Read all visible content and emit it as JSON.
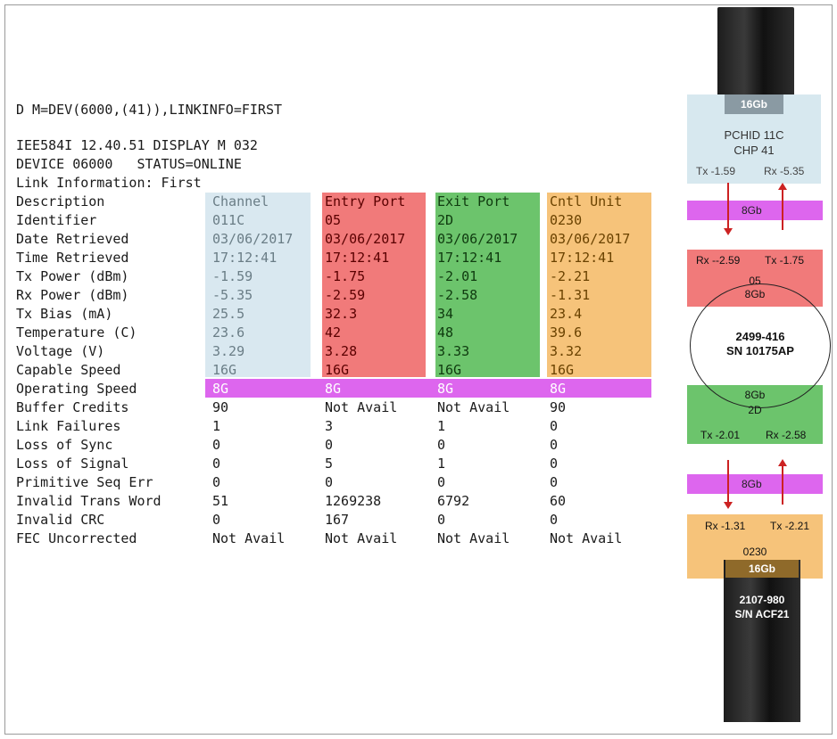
{
  "command": "D M=DEV(6000,(41)),LINKINFO=FIRST",
  "header_lines": [
    "IEE584I 12.40.51 DISPLAY M 032",
    "DEVICE 06000   STATUS=ONLINE",
    "Link Information: First"
  ],
  "table": {
    "description_label": "Description",
    "columns": [
      "Channel",
      "Entry Port",
      "Exit Port",
      "Cntl Unit"
    ],
    "column_colors": [
      "#d9e8f0",
      "#f17a7a",
      "#6cc46c",
      "#f6c37a"
    ],
    "rows": [
      {
        "label": "Identifier",
        "values": [
          "011C",
          "05",
          "2D",
          "0230"
        ]
      },
      {
        "label": "Date Retrieved",
        "values": [
          "03/06/2017",
          "03/06/2017",
          "03/06/2017",
          "03/06/2017"
        ]
      },
      {
        "label": "Time Retrieved",
        "values": [
          "17:12:41",
          "17:12:41",
          "17:12:41",
          "17:12:41"
        ]
      },
      {
        "label": "Tx Power (dBm)",
        "values": [
          "-1.59",
          "-1.75",
          "-2.01",
          "-2.21"
        ]
      },
      {
        "label": "Rx Power (dBm)",
        "values": [
          "-5.35",
          "-2.59",
          "-2.58",
          "-1.31"
        ]
      },
      {
        "label": "Tx Bias (mA)",
        "values": [
          "25.5",
          "32.3",
          "34",
          "23.4"
        ]
      },
      {
        "label": "Temperature (C)",
        "values": [
          "23.6",
          "42",
          "48",
          "39.6"
        ]
      },
      {
        "label": "Voltage (V)",
        "values": [
          "3.29",
          "3.28",
          "3.33",
          "3.32"
        ]
      },
      {
        "label": "Capable Speed",
        "values": [
          "16G",
          "16G",
          "16G",
          "16G"
        ]
      },
      {
        "label": "Operating Speed",
        "values": [
          "8G",
          "8G",
          "8G",
          "8G"
        ]
      },
      {
        "label": "Buffer Credits",
        "values": [
          "90",
          "Not Avail",
          "Not Avail",
          "90"
        ]
      },
      {
        "label": "Link Failures",
        "values": [
          "1",
          "3",
          "1",
          "0"
        ]
      },
      {
        "label": "Loss of Sync",
        "values": [
          "0",
          "0",
          "0",
          "0"
        ]
      },
      {
        "label": "Loss of Signal",
        "values": [
          "0",
          "5",
          "1",
          "0"
        ]
      },
      {
        "label": "Primitive Seq Err",
        "values": [
          "0",
          "0",
          "0",
          "0"
        ]
      },
      {
        "label": "Invalid Trans Word",
        "values": [
          "51",
          "1269238",
          "6792",
          "60"
        ]
      },
      {
        "label": "Invalid CRC",
        "values": [
          "0",
          "167",
          "0",
          "0"
        ]
      },
      {
        "label": "FEC Uncorrected",
        "values": [
          "Not Avail",
          "Not Avail",
          "Not Avail",
          "Not Avail"
        ]
      }
    ]
  },
  "diagram": {
    "host": {
      "speed": "16Gb",
      "pchid": "PCHID 11C",
      "chp": "CHP 41",
      "tx": "Tx -1.59",
      "rx": "Rx -5.35"
    },
    "link1_speed": "8Gb",
    "entry_port": {
      "rx": "Rx --2.59",
      "tx": "Tx -1.75",
      "id": "05",
      "speed": "8Gb"
    },
    "switch": {
      "model": "2499-416",
      "serial": "SN 10175AP"
    },
    "exit_port": {
      "speed": "8Gb",
      "id": "2D",
      "tx": "Tx -2.01",
      "rx": "Rx -2.58"
    },
    "link2_speed": "8Gb",
    "control_unit": {
      "rx": "Rx -1.31",
      "tx": "Tx -2.21",
      "id": "0230",
      "speed": "16Gb",
      "model": "2107-980",
      "serial": "S/N ACF21"
    }
  }
}
